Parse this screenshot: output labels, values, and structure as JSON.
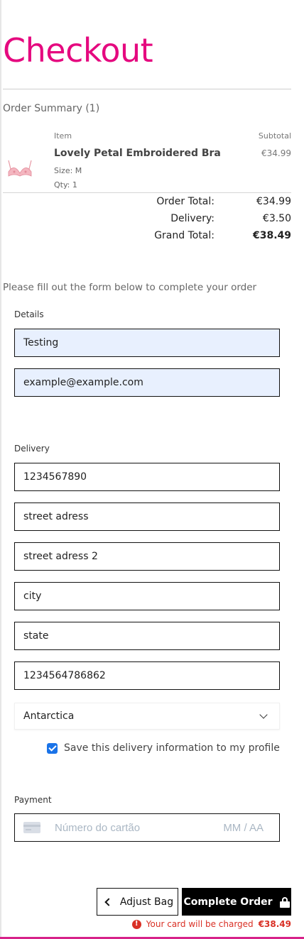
{
  "page": {
    "title": "Checkout"
  },
  "summary": {
    "heading": "Order Summary (1)",
    "col_item": "Item",
    "col_subtotal": "Subtotal",
    "product": {
      "name": "Lovely Petal Embroidered Bra",
      "price": "€34.99",
      "size": "Size: M",
      "qty": "Qty: 1"
    },
    "totals": [
      {
        "label": "Order Total:",
        "value": "€34.99"
      },
      {
        "label": "Delivery:",
        "value": "€3.50"
      },
      {
        "label": "Grand Total:",
        "value": "€38.49"
      }
    ]
  },
  "form": {
    "intro": "Please fill out the form below to complete your order",
    "details_label": "Details",
    "details": {
      "name": "Testing",
      "email": "example@example.com"
    },
    "delivery_label": "Delivery",
    "delivery": {
      "phone": "1234567890",
      "street1": "street adress",
      "street2": "street adress 2",
      "city": "city",
      "state": "state",
      "postcode": "1234564786862",
      "country": "Antarctica"
    },
    "save_info_label": "Save this delivery information to my profile",
    "save_info_checked": true,
    "payment_label": "Payment",
    "card_placeholder": "Número do cartão",
    "expiry_placeholder": "MM / AA"
  },
  "actions": {
    "adjust_bag": "Adjust Bag",
    "complete_order": "Complete Order",
    "charge_note": "Your card will be charged",
    "charge_amount": "€38.49"
  },
  "colors": {
    "brand": "#e5097f",
    "error": "#d93025",
    "autofill": "#e8f0fe",
    "checkbox": "#1a73e8"
  },
  "icons": [
    "bra-product-thumbnail",
    "chevron-down-icon",
    "checkbox-checked-icon",
    "credit-card-icon",
    "chevron-left-icon",
    "lock-icon",
    "error-icon"
  ]
}
